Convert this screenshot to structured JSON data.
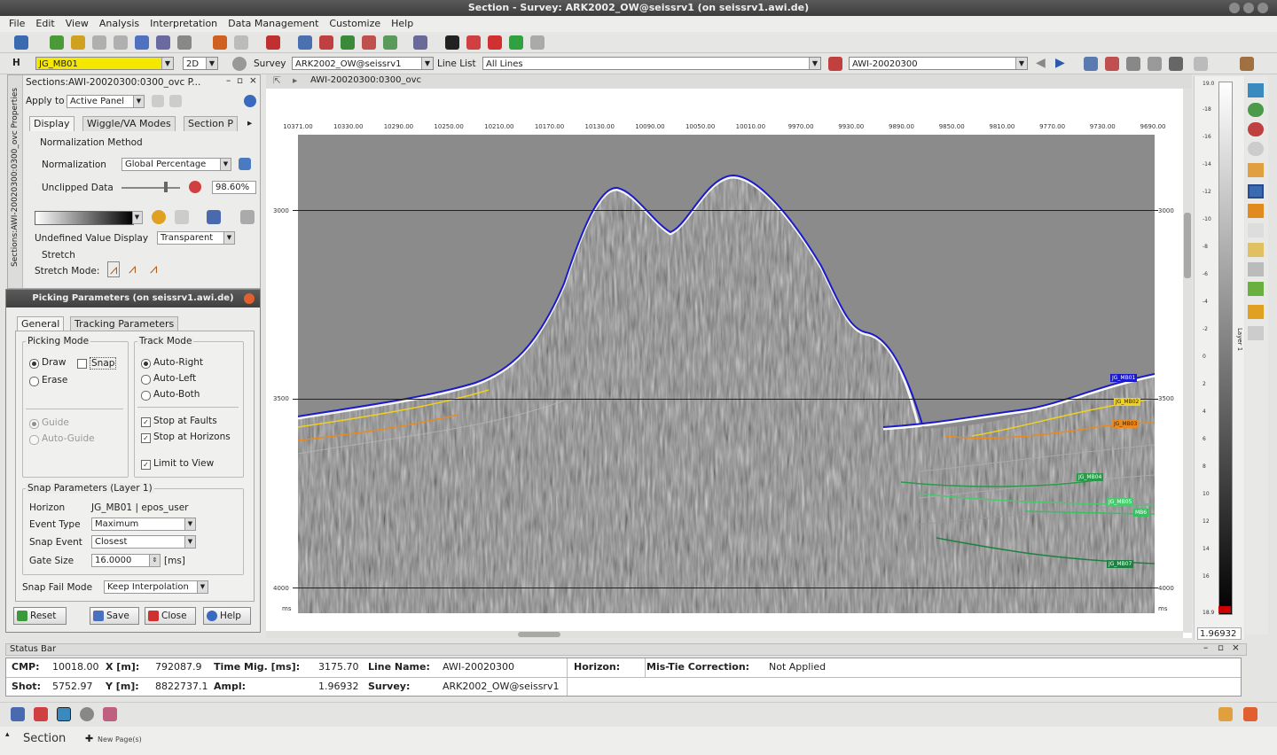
{
  "window": {
    "title": "Section - Survey: ARK2002_OW@seissrv1 (on seissrv1.awi.de)"
  },
  "menu": [
    "File",
    "Edit",
    "View",
    "Analysis",
    "Interpretation",
    "Data Management",
    "Customize",
    "Help"
  ],
  "toolbar2": {
    "horizon_prefix": "H",
    "horizon": "JG_MB01",
    "dim": "2D",
    "survey_label": "Survey",
    "survey": "ARK2002_OW@seissrv1",
    "linelist_label": "Line List",
    "linelist": "All Lines",
    "line": "AWI-20020300"
  },
  "props_panel": {
    "title": "Sections:AWI-20020300:0300_ovc P...",
    "side_label": "Sections:AWI-20020300:0300_ovc Properties",
    "apply_to_label": "Apply to",
    "apply_to": "Active Panel",
    "tabs": [
      "Display",
      "Wiggle/VA Modes",
      "Section P"
    ],
    "normalization_method_label": "Normalization Method",
    "normalization_label": "Normalization",
    "normalization": "Global Percentage",
    "unclipped_label": "Unclipped Data",
    "unclipped_value": "98.60%",
    "undefined_label": "Undefined Value Display",
    "undefined_value": "Transparent",
    "stretch_label": "Stretch",
    "stretch_mode_label": "Stretch Mode:"
  },
  "picking": {
    "title": "Picking Parameters (on seissrv1.awi.de)",
    "tabs": [
      "General",
      "Tracking Parameters"
    ],
    "picking_mode_label": "Picking Mode",
    "draw": "Draw",
    "snap": "Snap",
    "erase": "Erase",
    "guide": "Guide",
    "auto_guide": "Auto-Guide",
    "track_mode_label": "Track Mode",
    "auto_right": "Auto-Right",
    "auto_left": "Auto-Left",
    "auto_both": "Auto-Both",
    "stop_faults": "Stop at Faults",
    "stop_horizons": "Stop at Horizons",
    "limit_view": "Limit to View",
    "snap_params_label": "Snap Parameters (Layer 1)",
    "horizon_label": "Horizon",
    "horizon_value": "JG_MB01 | epos_user",
    "event_type_label": "Event Type",
    "event_type": "Maximum",
    "snap_event_label": "Snap Event",
    "snap_event": "Closest",
    "gate_size_label": "Gate Size",
    "gate_size": "16.0000",
    "gate_unit": "[ms]",
    "snap_fail_label": "Snap Fail Mode",
    "snap_fail": "Keep Interpolation",
    "buttons": {
      "reset": "Reset",
      "save": "Save",
      "close": "Close",
      "help": "Help"
    }
  },
  "section": {
    "tab_title": "AWI-20020300:0300_ovc",
    "x_ticks": [
      "10371.00",
      "10330.00",
      "10290.00",
      "10250.00",
      "10210.00",
      "10170.00",
      "10130.00",
      "10090.00",
      "10050.00",
      "10010.00",
      "9970.00",
      "9930.00",
      "9890.00",
      "9850.00",
      "9810.00",
      "9770.00",
      "9730.00",
      "9690.00"
    ],
    "y_ticks_left": [
      "3000",
      "3500",
      "4000"
    ],
    "y_ticks_right": [
      "3000",
      "3500",
      "4000"
    ],
    "unit_left": "ms",
    "unit_right": "ms",
    "horizon_labels": [
      "JG_MB01",
      "JG_MB02",
      "JG_MB03",
      "JG_MB04",
      "JG_MB05",
      "MB6",
      "JG_MB07"
    ],
    "horizon_colors": [
      "#1a1acc",
      "#f0d020",
      "#e88a20",
      "#2a9a4a",
      "#4ac870",
      "#38c060",
      "#1e8040"
    ]
  },
  "colorbar": {
    "top": "19.0",
    "bottom": "18.9",
    "ticks": [
      "-18",
      "-16",
      "-14",
      "-12",
      "-10",
      "-8",
      "-6",
      "-4",
      "-2",
      "0",
      "2",
      "4",
      "6",
      "8",
      "10",
      "12",
      "14",
      "16"
    ],
    "value": "1.96932",
    "side_label": "Layer 1"
  },
  "statusbar": {
    "title": "Status Bar",
    "row1": {
      "cmp_k": "CMP:",
      "cmp_v": "10018.00",
      "x_k": "X [m]:",
      "x_v": "792087.9",
      "tm_k": "Time Mig. [ms]:",
      "tm_v": "3175.70",
      "ln_k": "Line Name:",
      "ln_v": "AWI-20020300",
      "hz_k": "Horizon:",
      "hz_v": "",
      "mt_k": "Mis-Tie Correction:",
      "mt_v": "Not Applied"
    },
    "row2": {
      "shot_k": "Shot:",
      "shot_v": "5752.97",
      "y_k": "Y [m]:",
      "y_v": "8822737.1",
      "amp_k": "Ampl:",
      "amp_v": "1.96932",
      "sv_k": "Survey:",
      "sv_v": "ARK2002_OW@seissrv1"
    }
  },
  "bottom": {
    "tab": "Section",
    "new_page": "New Page(s)"
  }
}
